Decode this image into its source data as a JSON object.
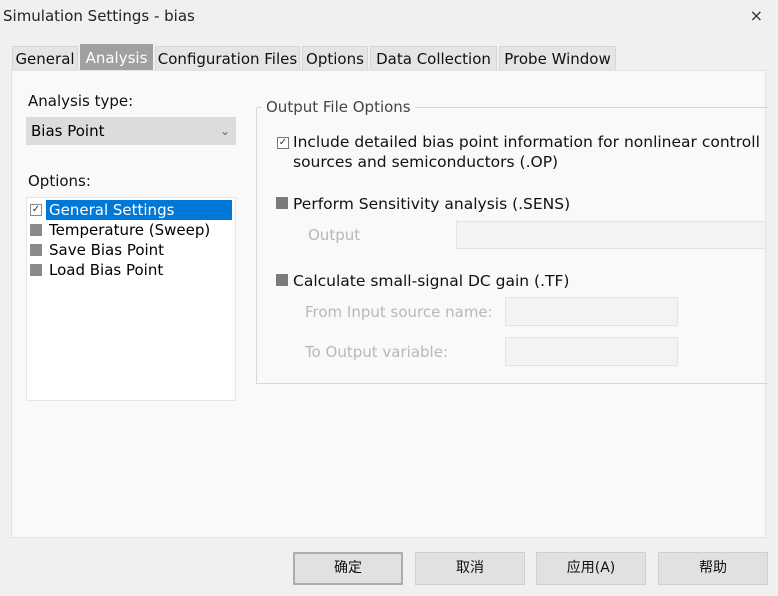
{
  "window": {
    "title": "Simulation Settings - bias",
    "close_icon": "×"
  },
  "tabs": [
    {
      "label": "General"
    },
    {
      "label": "Analysis",
      "active": true
    },
    {
      "label": "Configuration Files"
    },
    {
      "label": "Options"
    },
    {
      "label": "Data Collection"
    },
    {
      "label": "Probe Window"
    }
  ],
  "left": {
    "analysis_type_label": "Analysis type:",
    "analysis_type_value": "Bias Point",
    "options_label": "Options:",
    "options": [
      {
        "label": "General Settings",
        "checked": true,
        "selected": true
      },
      {
        "label": "Temperature (Sweep)",
        "checked": false
      },
      {
        "label": "Save Bias Point",
        "checked": false
      },
      {
        "label": "Load Bias Point",
        "checked": false
      }
    ]
  },
  "output_file_options": {
    "title": "Output File Options",
    "op": {
      "label_line1": "Include detailed bias point information for nonlinear controll",
      "label_line2": "sources and semiconductors (.OP)",
      "checked": true
    },
    "sens": {
      "label": "Perform Sensitivity analysis (.SENS)",
      "checked": false,
      "output_label": "Output",
      "output_value": ""
    },
    "tf": {
      "label": "Calculate small-signal DC gain (.TF)",
      "checked": false,
      "from_label": "From Input source name:",
      "from_value": "",
      "to_label": "To Output variable:",
      "to_value": ""
    }
  },
  "buttons": {
    "ok": "确定",
    "cancel": "取消",
    "apply": "应用(A)",
    "help": "帮助"
  },
  "colors": {
    "accent": "#0078d7",
    "active_tab": "#a0a0a0"
  }
}
